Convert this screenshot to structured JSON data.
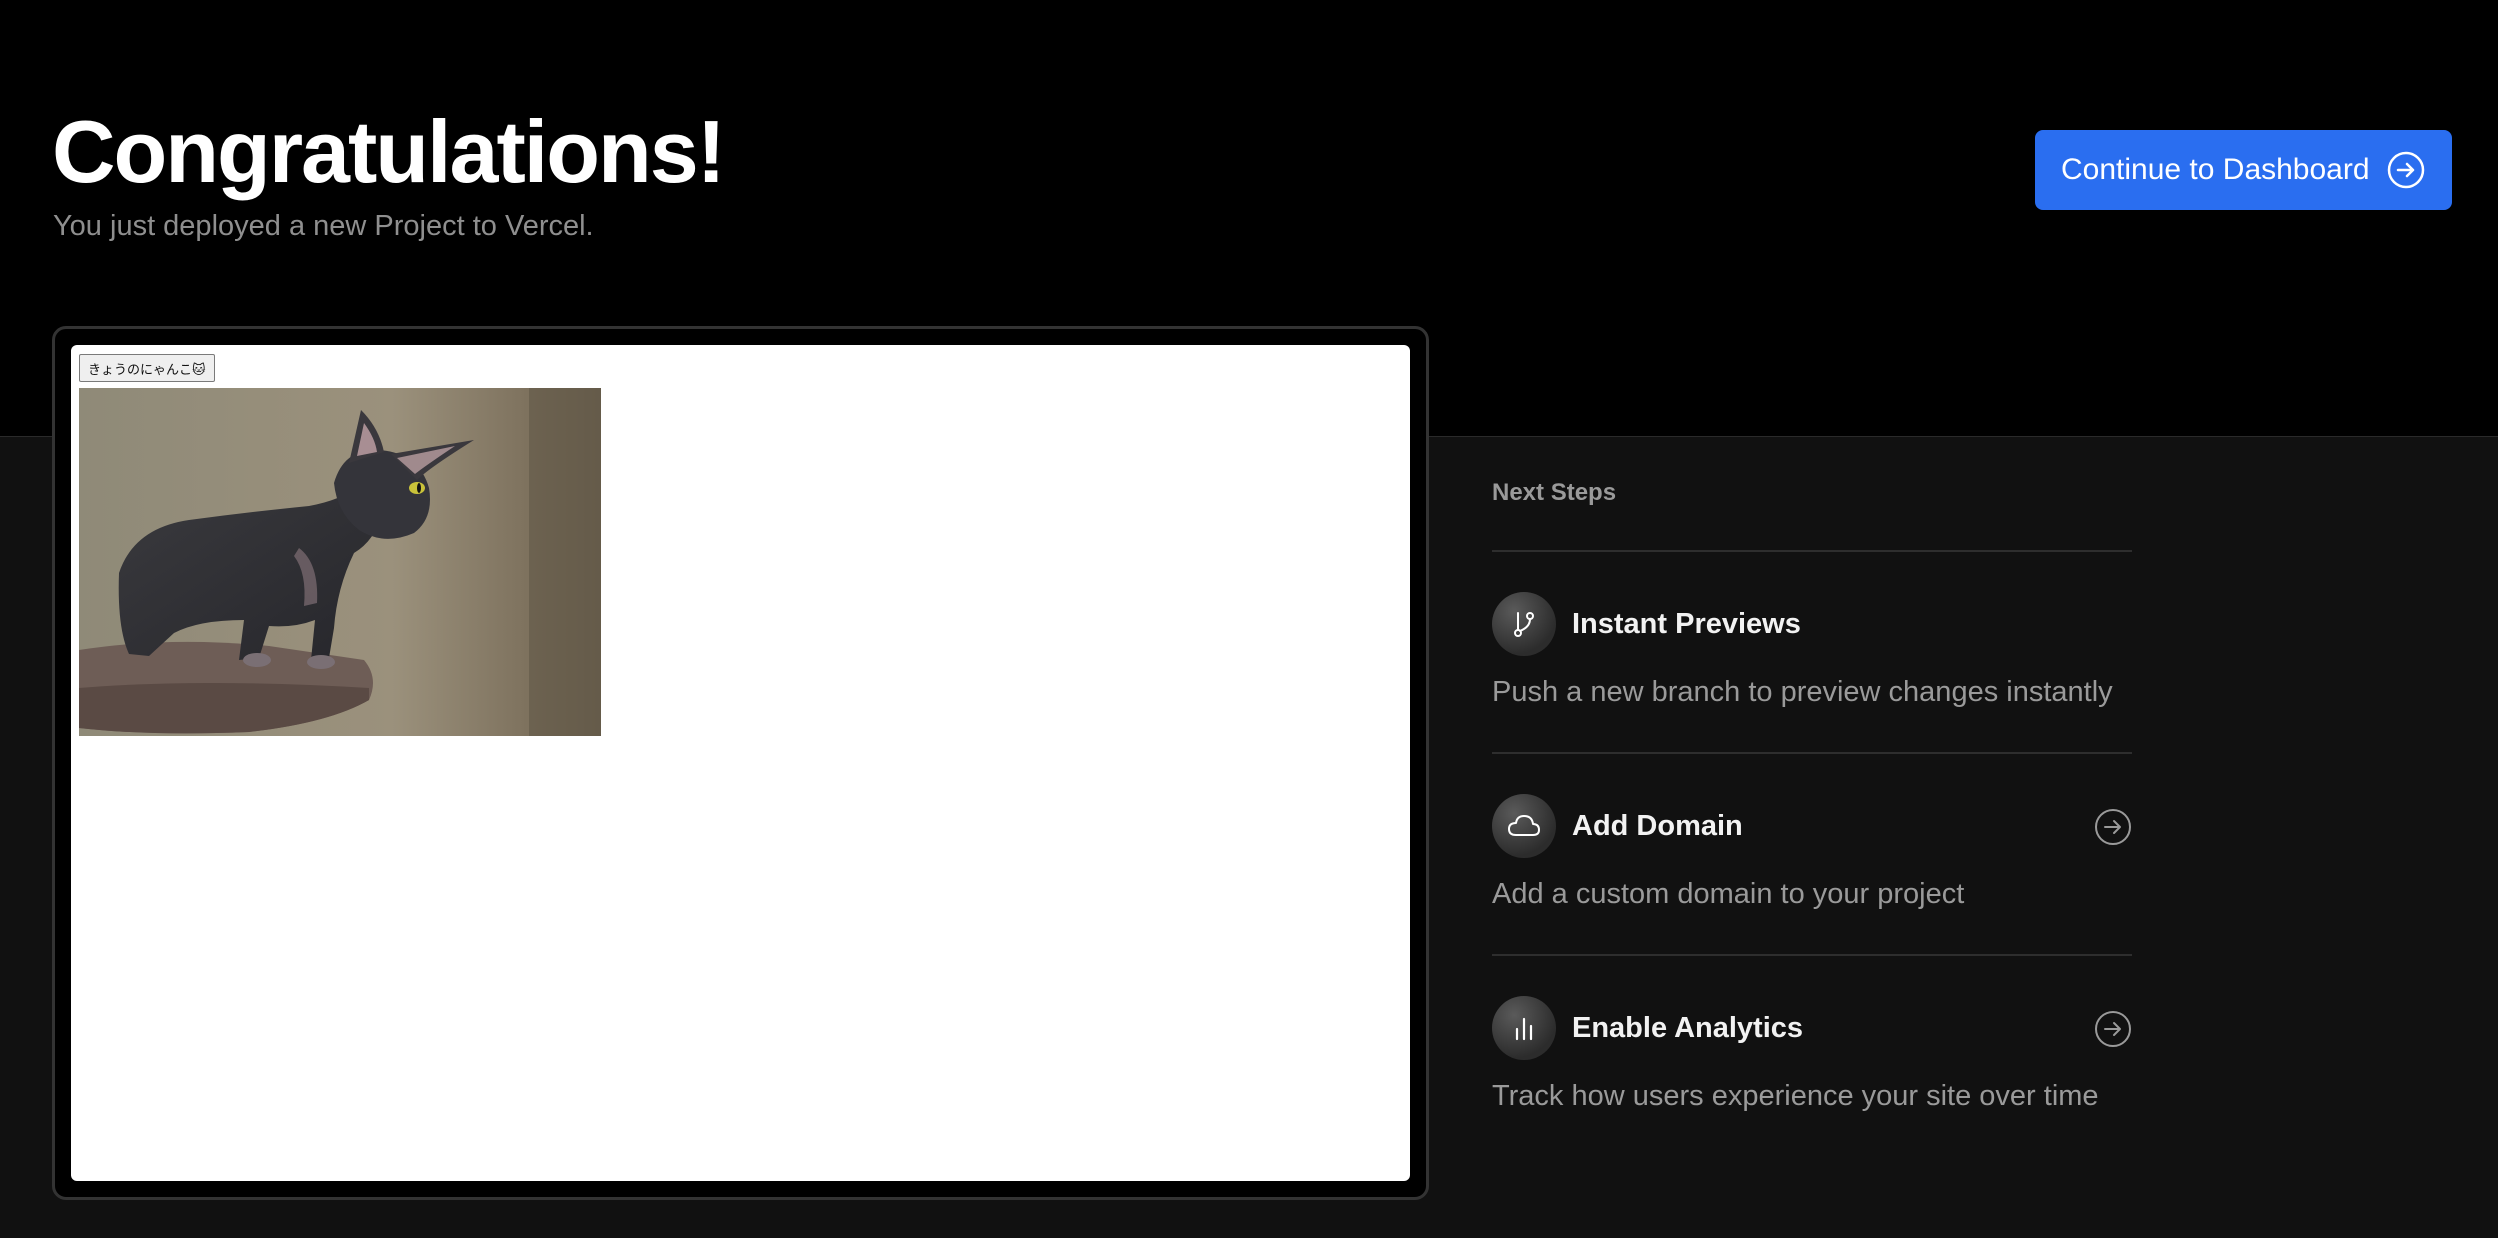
{
  "header": {
    "title": "Congratulations!",
    "subtitle": "You just deployed a new Project to Vercel.",
    "cta_label": "Continue to Dashboard",
    "cta_icon": "arrow-right-circle-icon",
    "accent_color": "#2a6ef0"
  },
  "preview": {
    "button_label": "きょうのにゃんこ🐱",
    "image_icon": "cat-photo"
  },
  "next_steps": {
    "heading": "Next Steps",
    "items": [
      {
        "title": "Instant Previews",
        "description": "Push a new branch to preview changes instantly",
        "icon": "git-branch-icon"
      },
      {
        "title": "Add Domain",
        "description": "Add a custom domain to your project",
        "icon": "cloud-icon"
      },
      {
        "title": "Enable Analytics",
        "description": "Track how users experience your site over time",
        "icon": "bar-chart-icon"
      }
    ]
  }
}
